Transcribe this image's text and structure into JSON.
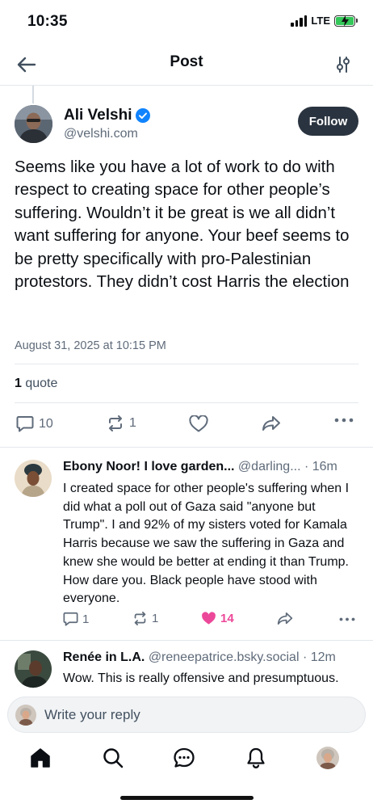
{
  "status_bar": {
    "time": "10:35",
    "network": "LTE"
  },
  "header": {
    "title": "Post"
  },
  "post": {
    "author_name": "Ali Velshi",
    "author_handle": "@velshi.com",
    "follow_label": "Follow",
    "text": "Seems like you have a lot of work to do with respect to creating space for other people’s suffering. Wouldn’t it be great is we all didn’t want suffering for anyone. Your beef seems to be pretty specifically with pro-Palestinian protestors. They didn’t cost Harris the election",
    "date": "August 31, 2025 at 10:15 PM",
    "quote_count": "1",
    "quote_label": "quote",
    "reply_count": "10",
    "repost_count": "1"
  },
  "replies": [
    {
      "name": "Ebony Noor! I love garden...",
      "handle": "@darling...",
      "time": "· 16m",
      "text": "I created space for other people's suffering when I did what a poll out of Gaza said \"anyone but Trump\". I and 92% of my sisters voted for Kamala Harris because we saw the suffering in Gaza and knew she would be better at ending it than Trump. How dare you. Black people have stood with everyone.",
      "reply_count": "1",
      "repost_count": "1",
      "like_count": "14"
    },
    {
      "name": "Renée in L.A.",
      "handle": "@reneepatrice.bsky.social",
      "time": "· 12m",
      "text": "Wow. This is really offensive and presumptuous."
    }
  ],
  "composer": {
    "placeholder": "Write your reply"
  },
  "colors": {
    "accent": "#1083fe",
    "like": "#ec4899",
    "follow_bg": "#2a3440",
    "muted": "#5f6b7a"
  }
}
